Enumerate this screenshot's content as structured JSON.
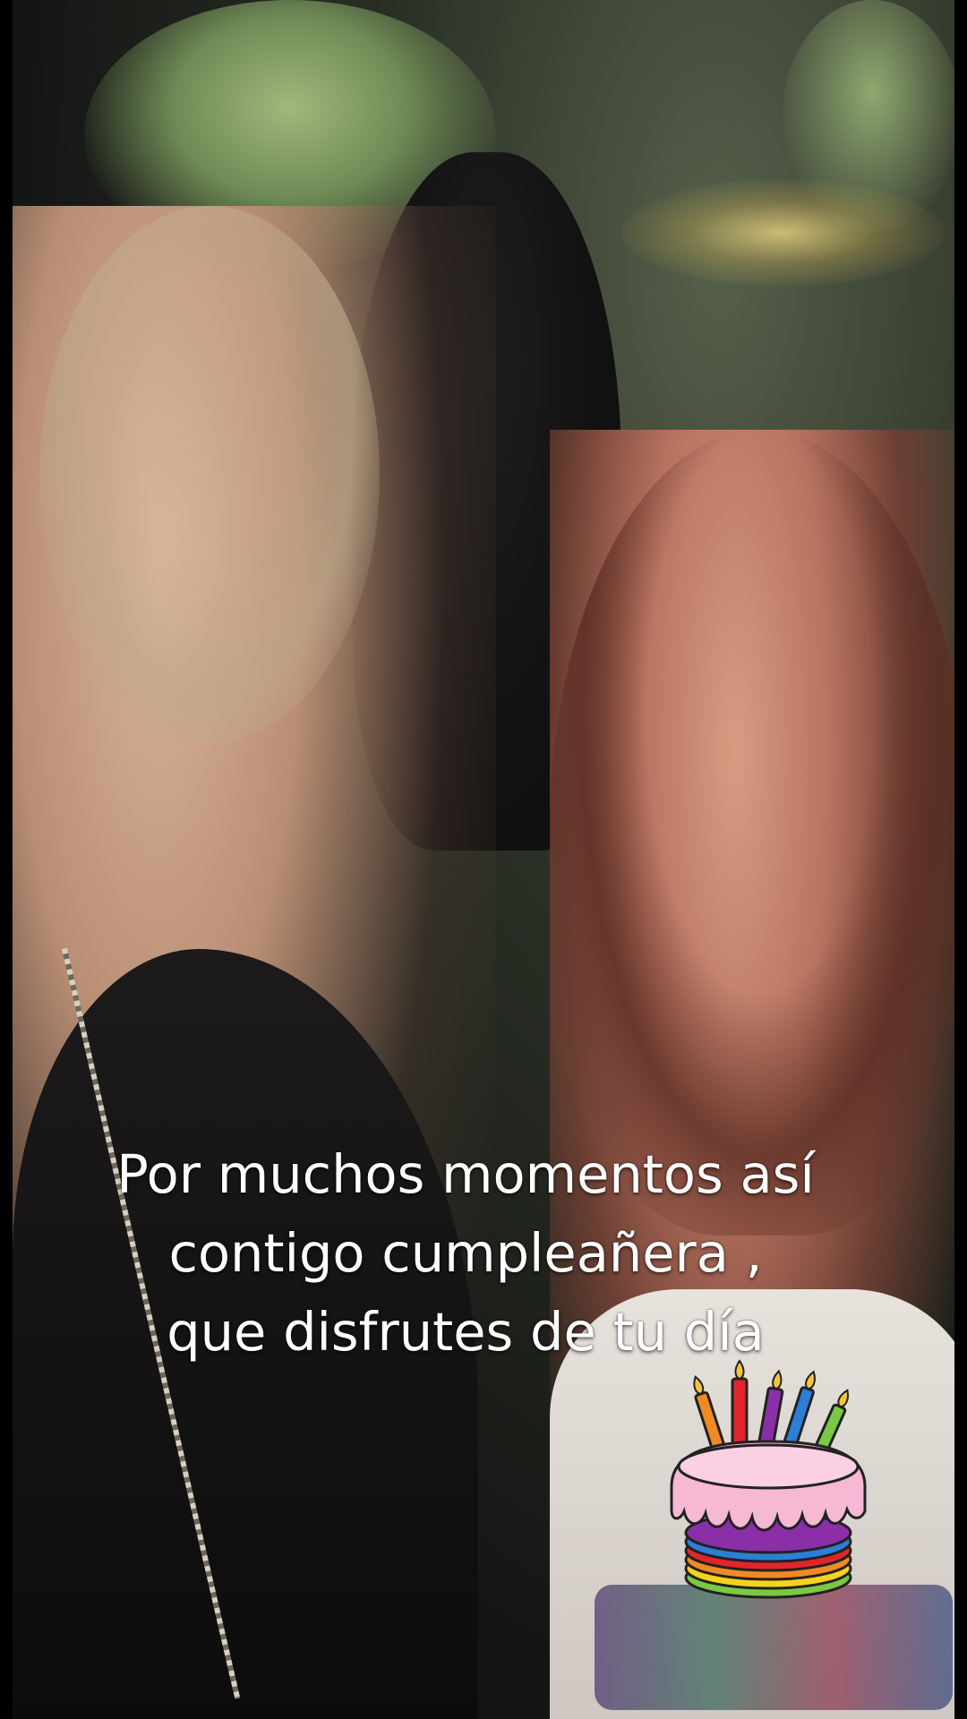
{
  "caption": {
    "line1": "Por muchos momentos así",
    "line2": "contigo cumpleañera ,",
    "line3": "que disfrutes de  tu día"
  },
  "sticker": {
    "icon": "birthday-cake-icon",
    "candle_colors": [
      "#f08a24",
      "#e0262b",
      "#8a2fa8",
      "#2d7fd6",
      "#7ac943"
    ],
    "frosting_color": "#f7b8d4",
    "layer_colors": [
      "#8a2fa8",
      "#2d7fd6",
      "#e0262b",
      "#f08a24",
      "#f5d31c",
      "#7ac943"
    ]
  }
}
